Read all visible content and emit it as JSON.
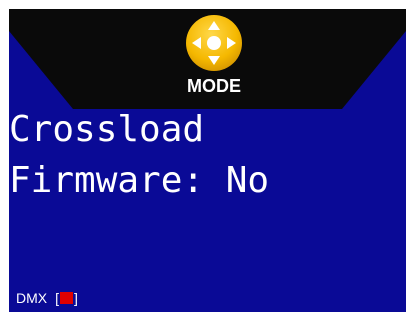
{
  "mode_button": {
    "label": "MODE",
    "icon": "dpad-arrows-icon",
    "icon_color": "#f5b800"
  },
  "main": {
    "line1": "Crossload",
    "line2": "Firmware: No"
  },
  "dmx": {
    "label": "DMX",
    "bracket_open": "[",
    "bracket_close": "]",
    "indicator_state": "inactive",
    "indicator_color": "#e00000"
  },
  "colors": {
    "screen_background": "#0a0a96",
    "banner_background": "#0a0a0a",
    "text": "#ffffff"
  }
}
